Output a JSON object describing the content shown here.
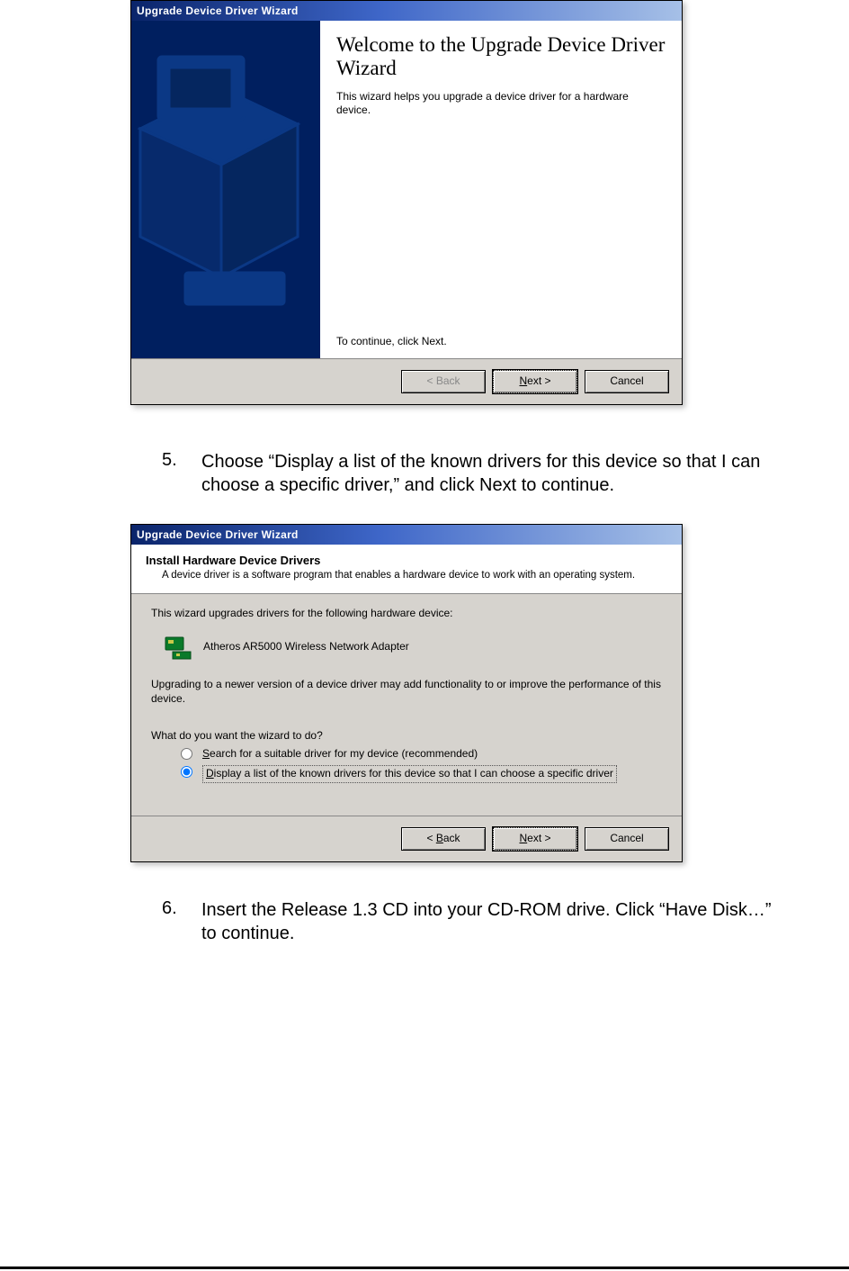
{
  "dialog1": {
    "title": "Upgrade Device Driver Wizard",
    "heading": "Welcome to the Upgrade Device Driver Wizard",
    "intro": "This wizard helps you upgrade a device driver for a hardware device.",
    "continue": "To continue, click Next.",
    "buttons": {
      "back": "< Back",
      "next": "Next >",
      "cancel": "Cancel"
    }
  },
  "step5": {
    "num": "5.",
    "text": "Choose “Display a list of the known drivers for this device so that I can choose a specific driver,” and click Next to continue."
  },
  "dialog2": {
    "title": "Upgrade Device Driver Wizard",
    "header_title": "Install Hardware Device Drivers",
    "header_sub": "A device driver is a software program that enables a hardware device to work with an operating system.",
    "line1": "This wizard upgrades drivers for the following hardware device:",
    "device_name": "Atheros AR5000 Wireless Network Adapter",
    "line2": "Upgrading to a newer version of a device driver may add functionality to or improve the performance of this device.",
    "prompt": "What do you want the wizard to do?",
    "option_search": "Search for a suitable driver for my device (recommended)",
    "option_display": "Display a list of the known drivers for this device so that I can choose a specific driver",
    "buttons": {
      "back": "< Back",
      "next": "Next >",
      "cancel": "Cancel"
    }
  },
  "step6": {
    "num": "6.",
    "text": "Insert the Release 1.3 CD into your CD-ROM drive. Click “Have Disk…” to continue."
  }
}
